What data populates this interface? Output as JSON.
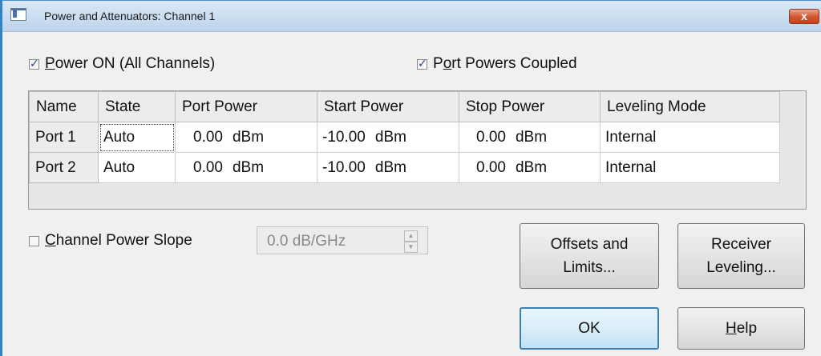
{
  "window": {
    "title": "Power and Attenuators: Channel 1",
    "close_label": "x"
  },
  "options": {
    "power_on": {
      "prefix": "",
      "accel": "P",
      "rest": "ower ON (All Channels)",
      "checked": true
    },
    "port_powers_coupled": {
      "prefix": "P",
      "accel": "o",
      "rest": "rt Powers Coupled",
      "checked": true
    }
  },
  "grid": {
    "columns": [
      "Name",
      "State",
      "Port Power",
      "Start Power",
      "Stop Power",
      "Leveling Mode"
    ],
    "rows": [
      {
        "name": "Port 1",
        "state": "Auto",
        "port_power": "0.00",
        "port_power_unit": "dBm",
        "start_power": "-10.00",
        "start_power_unit": "dBm",
        "stop_power": "0.00",
        "stop_power_unit": "dBm",
        "leveling_mode": "Internal"
      },
      {
        "name": "Port 2",
        "state": "Auto",
        "port_power": "0.00",
        "port_power_unit": "dBm",
        "start_power": "-10.00",
        "start_power_unit": "dBm",
        "stop_power": "0.00",
        "stop_power_unit": "dBm",
        "leveling_mode": "Internal"
      }
    ]
  },
  "slope": {
    "accel": "C",
    "rest": "hannel Power Slope",
    "checked": false,
    "value": "0.0 dB/GHz"
  },
  "buttons": {
    "offsets_line1": "Offsets and",
    "offsets_line2": "Limits...",
    "receiver_line1": "Receiver",
    "receiver_line2": "Leveling...",
    "ok": "OK",
    "help_accel": "H",
    "help_rest": "elp"
  }
}
